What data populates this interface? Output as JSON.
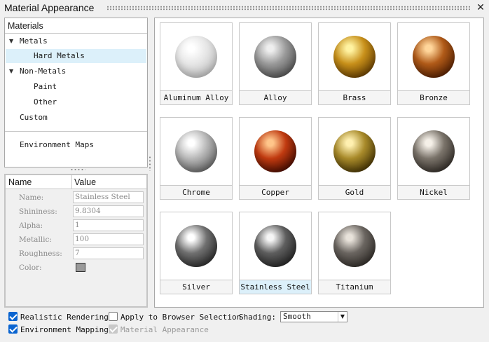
{
  "window": {
    "title": "Material Appearance"
  },
  "icons": {
    "close": "close-icon",
    "expanded": "triangle-down-icon"
  },
  "tree": {
    "header": "Materials",
    "items": [
      {
        "label": "Metals",
        "expander": "▼"
      },
      {
        "label": "Hard Metals"
      },
      {
        "label": "Non-Metals",
        "expander": "▼"
      },
      {
        "label": "Paint"
      },
      {
        "label": "Other"
      },
      {
        "label": "Custom"
      },
      {
        "label": "Environment Maps"
      }
    ],
    "selected": "Hard Metals"
  },
  "properties": {
    "headers": {
      "name": "Name",
      "value": "Value"
    },
    "rows": [
      {
        "label": "Name:",
        "value": "Stainless Steel"
      },
      {
        "label": "Shininess:",
        "value": "9.8304"
      },
      {
        "label": "Alpha:",
        "value": "1"
      },
      {
        "label": "Metallic:",
        "value": "100"
      },
      {
        "label": "Roughness:",
        "value": "7"
      },
      {
        "label": "Color:",
        "value": "#9a9a9a"
      }
    ]
  },
  "gallery": {
    "selected": "Stainless Steel",
    "materials": [
      {
        "name": "Aluminum Alloy",
        "base": "#e6e6e6",
        "light": "#ffffff",
        "dark": "#b8b8b8"
      },
      {
        "name": "Alloy",
        "base": "#9a9a9a",
        "light": "#eeeeee",
        "dark": "#4a4a4a"
      },
      {
        "name": "Brass",
        "base": "#c8901a",
        "light": "#fff2a0",
        "dark": "#5a3500"
      },
      {
        "name": "Bronze",
        "base": "#b05a18",
        "light": "#ffd59a",
        "dark": "#4a1a00"
      },
      {
        "name": "Chrome",
        "base": "#b8b8b8",
        "light": "#ffffff",
        "dark": "#5a5a5a"
      },
      {
        "name": "Copper",
        "base": "#c03a10",
        "light": "#ffc58a",
        "dark": "#3a0800"
      },
      {
        "name": "Gold",
        "base": "#a88a2a",
        "light": "#fff0b0",
        "dark": "#3a2a00"
      },
      {
        "name": "Nickel",
        "base": "#7a736a",
        "light": "#f5f0e8",
        "dark": "#2a2520"
      },
      {
        "name": "Silver",
        "base": "#707070",
        "light": "#ffffff",
        "dark": "#222222"
      },
      {
        "name": "Stainless Steel",
        "base": "#5e5e5e",
        "light": "#f5f5f5",
        "dark": "#1e1e1e"
      },
      {
        "name": "Titanium",
        "base": "#6a6560",
        "light": "#e8e2da",
        "dark": "#2a2622"
      }
    ]
  },
  "options": {
    "realistic_rendering": {
      "label": "Realistic Rendering",
      "checked": true
    },
    "apply_browser": {
      "label": "Apply to Browser Selection",
      "checked": false
    },
    "environment_mapping": {
      "label": "Environment Mapping",
      "checked": true
    },
    "material_appearance": {
      "label": "Material Appearance",
      "checked": true,
      "disabled": true
    },
    "shading": {
      "label": "Shading:",
      "value": "Smooth"
    }
  }
}
